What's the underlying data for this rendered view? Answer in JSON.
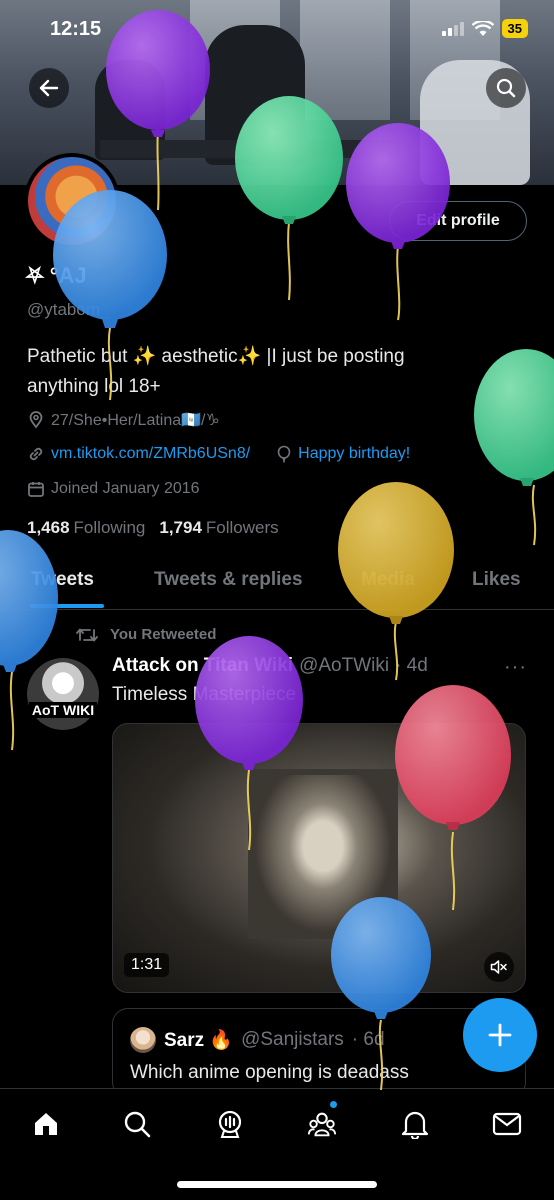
{
  "status_bar": {
    "time": "12:15",
    "battery": "35"
  },
  "profile": {
    "display_name": "⛧ °AJ",
    "handle": "@ytabom_",
    "edit_button": "Edit profile",
    "bio_line1": "Pathetic but ✨ aesthetic✨ |I just be posting",
    "bio_line2": "anything lol 18+",
    "location": "27/She•Her/Latina🇬🇹/♑",
    "website": "vm.tiktok.com/ZMRb6USn8/",
    "birthday": "Happy birthday!",
    "joined": "Joined January 2016",
    "following_count": "1,468",
    "following_label": "Following",
    "followers_count": "1,794",
    "followers_label": "Followers"
  },
  "tabs": [
    "Tweets",
    "Tweets & replies",
    "Media",
    "Likes"
  ],
  "tweet": {
    "retweet_label": "You Retweeted",
    "author_name": "Attack on Titan Wiki",
    "author_handle": "@AoTWiki",
    "time": "· 4d",
    "more": "···",
    "text": "Timeless Masterpiece",
    "avatar_text": "AoT WIKI",
    "video_duration": "1:31",
    "quote": {
      "author_name": "Sarz 🔥",
      "author_handle": "@Sanjistars",
      "time": "· 6d",
      "text": "Which anime opening is deadass"
    }
  },
  "colors": {
    "accent": "#1d9bf0",
    "balloon_purple": "#8a2be2",
    "balloon_green": "#3fcf8e",
    "balloon_blue": "#3a8ee6",
    "balloon_yellow": "#d9b22a",
    "balloon_red": "#e0455f"
  },
  "icons": {
    "back": "back-arrow-icon",
    "search": "search-icon",
    "location": "location-pin-icon",
    "link": "link-icon",
    "birthday": "balloon-icon",
    "calendar": "calendar-icon",
    "retweet": "retweet-icon",
    "mute": "mute-icon",
    "compose": "plus-icon",
    "nav": [
      "home-icon",
      "search-icon",
      "spaces-icon",
      "communities-icon",
      "notifications-icon",
      "messages-icon"
    ]
  }
}
